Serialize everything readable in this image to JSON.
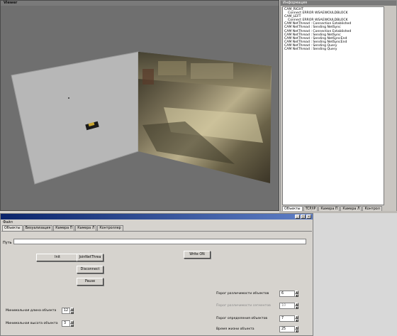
{
  "viewer": {
    "title": "Viewer"
  },
  "info": {
    "title": "Информация",
    "log": [
      {
        "text": "CAM_RIGHT",
        "indent": false
      },
      {
        "text": "Connect ERROR WSAEWOULDBLOCK",
        "indent": true
      },
      {
        "text": "CAM_LEFT",
        "indent": false
      },
      {
        "text": "Connect ERROR WSAEWOULDBLOCK",
        "indent": true
      },
      {
        "text": "CAM NetThread : Connection Established",
        "indent": false
      },
      {
        "text": "CAM NetThread : Sending NetSync",
        "indent": false
      },
      {
        "text": "CAM NetThread : Connection Established",
        "indent": false
      },
      {
        "text": "CAM NetThread : Sending NetSync",
        "indent": false
      },
      {
        "text": "CAM NetThread : Sending NetSyncEnd",
        "indent": false
      },
      {
        "text": "CAM NetThread : Sending NetSyncEnd",
        "indent": false
      },
      {
        "text": "CAM NetThread : Sending Query",
        "indent": false
      },
      {
        "text": "CAM NetThread : Sending Query",
        "indent": false
      }
    ],
    "tabs": [
      "Объекты",
      "TCP/IP",
      "Камера П",
      "Камера Л",
      "Контрол"
    ],
    "active_tab": "Объекты"
  },
  "main": {
    "menu": "Файл",
    "tabs": [
      "Объекты",
      "Визуализация",
      "Камера П",
      "Камера Л",
      "Контроллер"
    ],
    "path_label": "Путь",
    "path_value": "",
    "buttons": {
      "init": "Init",
      "join": "JoinNetThrea",
      "disconnect": "Disconnect",
      "pause": "Pause",
      "write": "Write ON"
    },
    "params_left": [
      {
        "label": "Минимальная длина объекта",
        "value": "12"
      },
      {
        "label": "Минимальная высота объекта",
        "value": "3"
      }
    ],
    "params_right": [
      {
        "label": "Порог различимости объектов",
        "value": "6",
        "disabled": false
      },
      {
        "label": "Порог различимости сегментов",
        "value": "10",
        "disabled": true
      },
      {
        "label": "Порог определения объектов",
        "value": "7",
        "disabled": false
      },
      {
        "label": "Время жизни объекта",
        "value": "25",
        "disabled": false
      }
    ]
  },
  "colors": {
    "title_start": "#0a246a",
    "title_end": "#5f7fc6",
    "viewer_bg": "#6f6f6f",
    "panel_bg": "#d6d3ce"
  },
  "icons": {
    "minimize": "minimize-icon",
    "maximize": "maximize-icon",
    "close": "close-icon"
  }
}
